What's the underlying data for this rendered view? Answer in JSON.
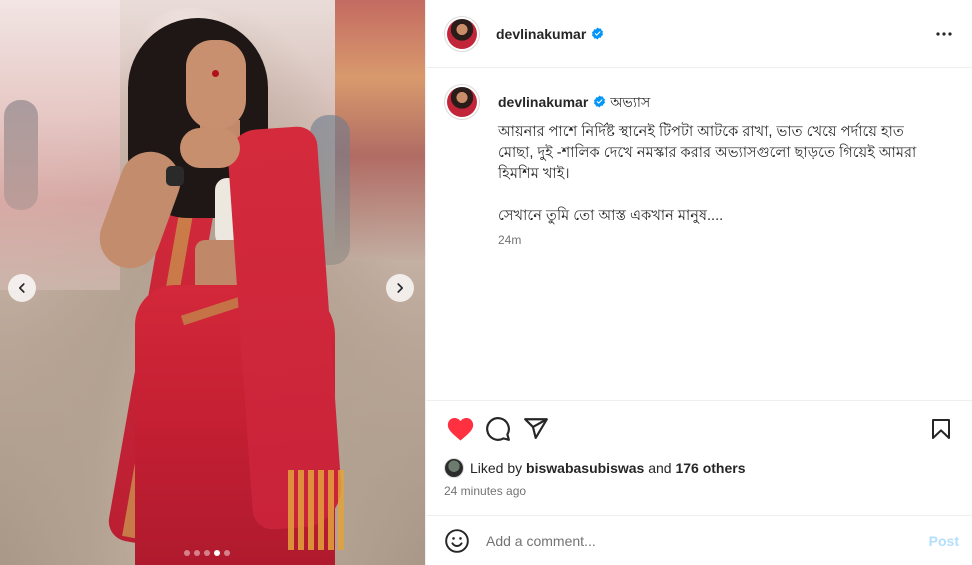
{
  "post": {
    "username": "devlinakumar",
    "more_icon": "more-horizontal-icon",
    "verified_icon": "verified-badge-icon"
  },
  "caption": {
    "username": "devlinakumar",
    "title": "অভ্যাস",
    "text": "আয়নার পাশে নির্দিষ্ট স্থানেই টিপটা আটকে রাখা, ভাত খেয়ে পর্দায়ে হাত মোছা, দুই -শালিক দেখে নমস্কার করার অভ্যাসগুলো ছাড়তে গিয়েই আমরা হিমশিম খাই।\n\nসেখানে তুমি তো আস্ত একখান মানুষ....",
    "time": "24m"
  },
  "carousel": {
    "prev_icon": "chevron-left-icon",
    "next_icon": "chevron-right-icon",
    "dot_count": 5,
    "active_index": 3
  },
  "actions": {
    "like_icon": "heart-filled-icon",
    "comment_icon": "comment-icon",
    "share_icon": "send-icon",
    "save_icon": "bookmark-icon",
    "like_color": "#ff3040"
  },
  "likes": {
    "prefix": "Liked by",
    "user": "biswabasubiswas",
    "joiner": "and",
    "others": "176 others"
  },
  "timestamp": "24 minutes ago",
  "comment": {
    "placeholder": "Add a comment...",
    "post_label": "Post",
    "emoji_icon": "emoji-smile-icon"
  },
  "colors": {
    "verified": "#0095f6",
    "post_disabled": "#b2dffc",
    "muted": "#737373"
  }
}
